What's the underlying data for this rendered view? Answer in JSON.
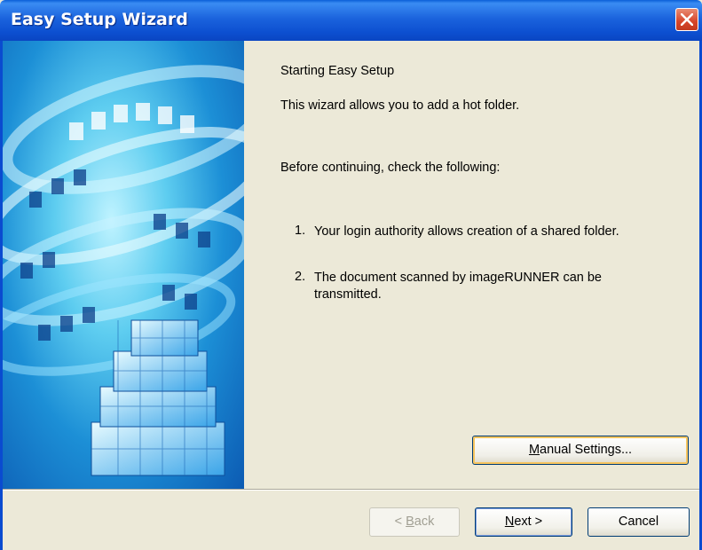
{
  "window": {
    "title": "Easy Setup Wizard"
  },
  "content": {
    "heading": "Starting Easy Setup",
    "intro": "This wizard allows you to add a hot folder.",
    "check_prompt": "Before continuing, check the following:",
    "items": [
      {
        "number": "1.",
        "text": "Your login authority allows creation of a shared folder."
      },
      {
        "number": "2.",
        "text": "The document scanned by imageRUNNER can be transmitted."
      }
    ]
  },
  "buttons": {
    "manual_settings": {
      "label": "Manual Settings...",
      "mnemonic": "M"
    },
    "back": {
      "label": "< Back",
      "mnemonic": "B",
      "enabled": false
    },
    "next": {
      "label": "Next >",
      "mnemonic": "N"
    },
    "cancel": {
      "label": "Cancel"
    }
  }
}
